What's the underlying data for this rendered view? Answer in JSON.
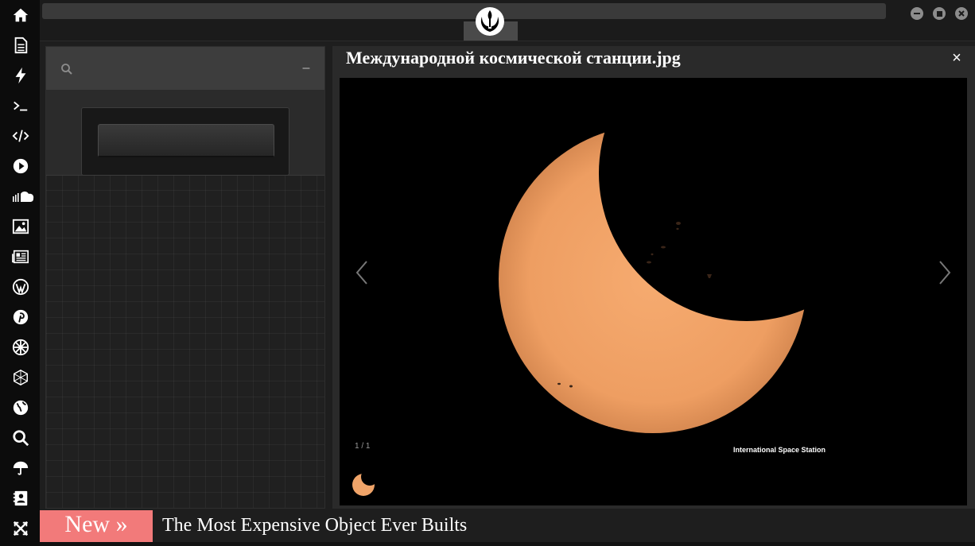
{
  "sidebar": {
    "icons": [
      "home-icon",
      "document-icon",
      "bolt-icon",
      "terminal-icon",
      "code-icon",
      "play-icon",
      "soundcloud-icon",
      "image-icon",
      "newspaper-icon",
      "wordpress-icon",
      "pinterest-icon",
      "galactic-empire-icon",
      "hexagon-globe-icon",
      "globe-icon",
      "search-icon",
      "umbrella-icon",
      "contact-card-icon",
      "expand-icon"
    ]
  },
  "window": {
    "logo": "rebel-alliance-icon",
    "controls": [
      "minimize-icon",
      "maximize-icon",
      "close-icon"
    ]
  },
  "left_panel": {
    "search_icon": "search-icon",
    "collapse_label": "–"
  },
  "viewer": {
    "title": "Международной космической станции.jpg",
    "close_label": "×",
    "counter": "1 / 1",
    "image_caption": "International Space Station",
    "colors": {
      "sun": "#f0a469",
      "background": "#000000"
    }
  },
  "ticker": {
    "badge": "New »",
    "headline": "The Most Expensive Object Ever Builts",
    "badge_color": "#f27a7a"
  }
}
